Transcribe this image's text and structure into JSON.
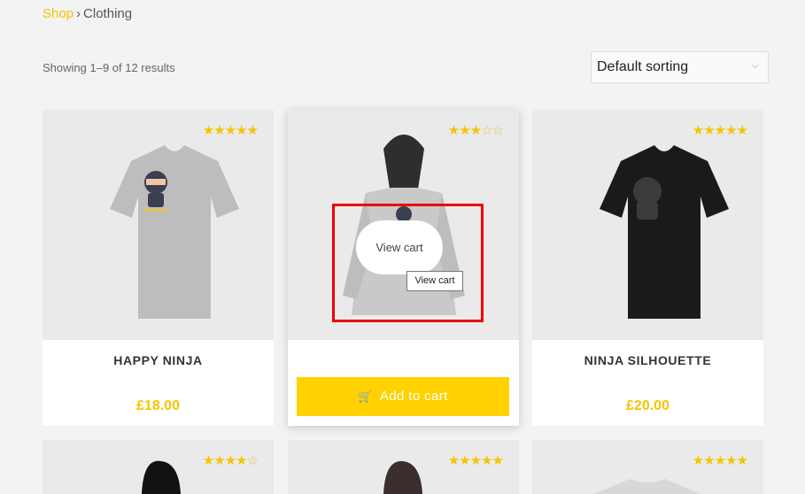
{
  "breadcrumb": {
    "shop": "Shop",
    "separator": "›",
    "current": "Clothing"
  },
  "result_count": "Showing 1–9 of 12 results",
  "sorting": {
    "selected": "Default sorting"
  },
  "products": [
    {
      "title": "HAPPY NINJA",
      "price": "£18.00",
      "rating_stars": "★★★★★",
      "rating_empty": ""
    },
    {
      "title": "",
      "price": "",
      "rating_stars": "★★★",
      "rating_empty": "☆☆",
      "add_to_cart": "Add to cart",
      "view_cart": "View cart",
      "tooltip": "View cart"
    },
    {
      "title": "NINJA SILHOUETTE",
      "price": "£20.00",
      "rating_stars": "★★★★★",
      "rating_empty": ""
    },
    {
      "title": "",
      "price": "",
      "rating_stars": "★★★★",
      "rating_empty": "☆"
    },
    {
      "title": "",
      "price": "",
      "rating_stars": "★★★★★",
      "rating_empty": ""
    },
    {
      "title": "",
      "price": "",
      "rating_stars": "★★★★★",
      "rating_empty": ""
    }
  ],
  "colors": {
    "accent": "#ffd200",
    "link": "#f5c500",
    "highlight": "#e00000"
  }
}
